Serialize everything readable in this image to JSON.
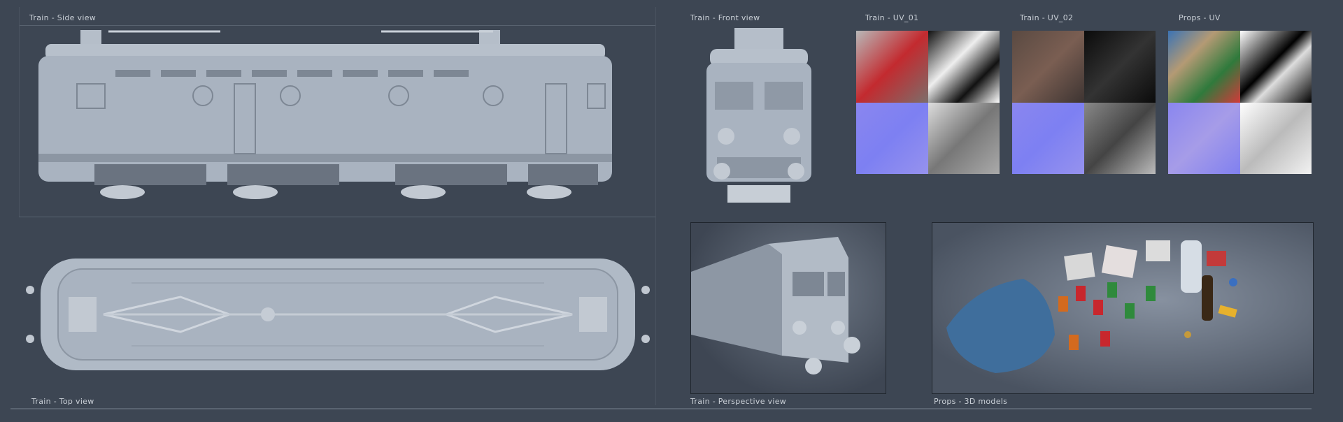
{
  "labels": {
    "side_view": "Train - Side view",
    "front_view": "Train - Front view",
    "uv_01": "Train - UV_01",
    "uv_02": "Train - UV_02",
    "props_uv": "Props - UV",
    "top_view": "Train - Top view",
    "perspective_view": "Train - Perspective view",
    "props_3d": "Props - 3D models"
  },
  "colors": {
    "background": "#3d4653",
    "model_clay": "#a9b3c0",
    "label_text": "#c9cfd6",
    "normal_map": "#8080f0"
  }
}
